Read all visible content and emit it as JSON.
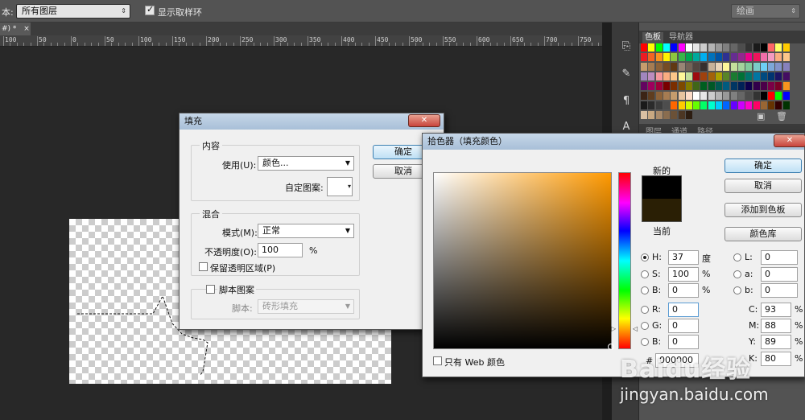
{
  "options_bar": {
    "sample_label": "本:",
    "sample_value": "所有图层",
    "show_ring_label": "显示取样环",
    "show_ring_checked": true,
    "workspace_value": "绘画"
  },
  "document_tab": {
    "label": "#) *",
    "close": "×"
  },
  "ruler": {
    "labels": [
      "100",
      "50",
      "0",
      "50",
      "100",
      "150",
      "200",
      "250",
      "300",
      "350",
      "400",
      "450",
      "500",
      "550",
      "600",
      "650",
      "700",
      "750"
    ]
  },
  "panel": {
    "tabs": [
      "色板",
      "导航器"
    ],
    "lower_tabs": [
      "图层",
      "通道",
      "路径"
    ],
    "swatch_colors": [
      [
        "#ff0000",
        "#ffff00",
        "#00ff00",
        "#00ffff",
        "#0000ff",
        "#ff00ff",
        "#ffffff",
        "#e6e6e6",
        "#cccccc",
        "#b3b3b3",
        "#999999",
        "#808080",
        "#666666",
        "#4d4d4d",
        "#333333",
        "#1a1a1a",
        "#000000",
        "#ff6666",
        "#ffff66",
        "#ffcc00"
      ],
      [
        "#ed1c24",
        "#f26522",
        "#f7941d",
        "#fff200",
        "#8dc63f",
        "#39b54a",
        "#00a651",
        "#00a99d",
        "#00aeef",
        "#0072bc",
        "#0054a6",
        "#2e3192",
        "#662d91",
        "#92278f",
        "#ec008c",
        "#ed145b",
        "#f06eaa",
        "#f49ac1",
        "#f9ad81",
        "#fdc689"
      ],
      [
        "#c69c6d",
        "#a67c52",
        "#8c6239",
        "#754c24",
        "#603913",
        "#998675",
        "#736357",
        "#534741",
        "#362f2d",
        "#c7b299",
        "#e9d4b8",
        "#fff799",
        "#c4df9b",
        "#a3d39c",
        "#82ca9c",
        "#7accc8",
        "#6dcff6",
        "#7da7d9",
        "#8393ca",
        "#8781bd"
      ],
      [
        "#a186be",
        "#bd8cbf",
        "#f5989d",
        "#f9ad81",
        "#fdc689",
        "#fff799",
        "#c4df9b",
        "#9e0b0f",
        "#a0410d",
        "#a36209",
        "#aba000",
        "#598527",
        "#1a7b30",
        "#007236",
        "#00746b",
        "#0076a3",
        "#004a80",
        "#003471",
        "#1b1464",
        "#440e62"
      ],
      [
        "#630460",
        "#9e005d",
        "#9e0039",
        "#790000",
        "#7b2e00",
        "#7d4900",
        "#827b00",
        "#406618",
        "#005e20",
        "#005826",
        "#005952",
        "#005b7f",
        "#003663",
        "#002157",
        "#0d004c",
        "#32004b",
        "#4b0049",
        "#7b0046",
        "#7a0026",
        "#f7941d"
      ],
      [
        "#3c2415",
        "#5f3d1f",
        "#8c6239",
        "#a67c52",
        "#c69c6d",
        "#e8c39e",
        "#fddbc7",
        "#ffffff",
        "#e6e6e6",
        "#cccccc",
        "#b3b3b3",
        "#999999",
        "#808080",
        "#666666",
        "#4d4d4d",
        "#333333",
        "#000000",
        "#ff0000",
        "#00ff00",
        "#0000ff"
      ],
      [
        "#1a1a1a",
        "#2b2b2b",
        "#3c3c3c",
        "#4d4d4d",
        "#ff6600",
        "#ffcc00",
        "#ccff00",
        "#66ff00",
        "#00ff66",
        "#00ffcc",
        "#00ccff",
        "#0066ff",
        "#6600ff",
        "#cc00ff",
        "#ff00cc",
        "#ff0066",
        "#996633",
        "#663300",
        "#330000",
        "#003300"
      ],
      [
        "#d9c0a3",
        "#c8a882",
        "#a98a6a",
        "#8a6d4f",
        "#6b5137",
        "#4c3623",
        "#2d1d11"
      ]
    ]
  },
  "fill_dialog": {
    "title": "填充",
    "close": "✕",
    "content_group": "内容",
    "use_label": "使用(U):",
    "use_value": "颜色...",
    "custom_pattern_label": "自定图案:",
    "blend_group": "混合",
    "mode_label": "模式(M):",
    "mode_value": "正常",
    "opacity_label": "不透明度(O):",
    "opacity_value": "100",
    "opacity_unit": "%",
    "preserve_label": "保留透明区域(P)",
    "script_checkbox_label": "脚本图案",
    "script_label": "脚本:",
    "script_value": "砖形填充",
    "ok": "确定",
    "cancel": "取消"
  },
  "picker_dialog": {
    "title": "拾色器（填充颜色）",
    "close": "✕",
    "new_label": "新的",
    "current_label": "当前",
    "ok": "确定",
    "cancel": "取消",
    "add_swatch": "添加到色板",
    "color_libraries": "颜色库",
    "web_only": "只有 Web 颜色",
    "hue_color": "#ff9900",
    "new_color": "#000000",
    "current_color": "#2a1f05",
    "H": {
      "label": "H:",
      "value": "37",
      "unit": "度"
    },
    "S": {
      "label": "S:",
      "value": "100",
      "unit": "%"
    },
    "B": {
      "label": "B:",
      "value": "0",
      "unit": "%"
    },
    "R": {
      "label": "R:",
      "value": "0"
    },
    "G": {
      "label": "G:",
      "value": "0"
    },
    "Bb": {
      "label": "B:",
      "value": "0"
    },
    "L": {
      "label": "L:",
      "value": "0"
    },
    "a": {
      "label": "a:",
      "value": "0"
    },
    "b": {
      "label": "b:",
      "value": "0"
    },
    "C": {
      "label": "C:",
      "value": "93",
      "unit": "%"
    },
    "M": {
      "label": "M:",
      "value": "88",
      "unit": "%"
    },
    "Y": {
      "label": "Y:",
      "value": "89",
      "unit": "%"
    },
    "K": {
      "label": "K:",
      "value": "80",
      "unit": "%"
    },
    "hex_label": "#",
    "hex_value": "000000"
  },
  "watermark": {
    "brand": "Baidu经验",
    "url": "jingyan.baidu.com"
  }
}
